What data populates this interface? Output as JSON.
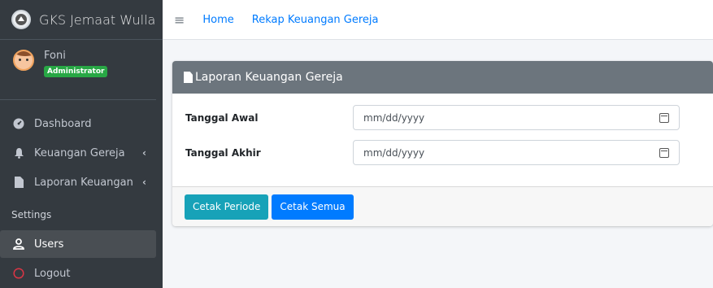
{
  "brand": {
    "title": "GKS Jemaat Wulla",
    "icon": "church-logo-icon"
  },
  "user": {
    "name": "Foni",
    "role": "Administrator"
  },
  "sidebar": {
    "items": [
      {
        "label": "Dashboard",
        "icon": "dashboard-icon"
      },
      {
        "label": "Keuangan Gereja",
        "icon": "bell-icon",
        "chevron": "‹"
      },
      {
        "label": "Laporan Keuangan",
        "icon": "file-icon",
        "chevron": "‹"
      }
    ],
    "section_header": "Settings",
    "settings_items": [
      {
        "label": "Users",
        "icon": "user-icon",
        "active": true
      },
      {
        "label": "Logout",
        "icon": "power-icon"
      }
    ]
  },
  "topbar": {
    "menu_icon": "≡",
    "links": [
      "Home",
      "Rekap Keuangan Gereja"
    ]
  },
  "card": {
    "title": "Laporan Keuangan Gereja",
    "fields": [
      {
        "label": "Tanggal Awal",
        "placeholder": "mm/dd/yyyy"
      },
      {
        "label": "Tanggal Akhir",
        "placeholder": "mm/dd/yyyy"
      }
    ],
    "buttons": {
      "period": "Cetak Periode",
      "all": "Cetak Semua"
    }
  },
  "colors": {
    "sidebar": "#343a40",
    "primary": "#007bff",
    "info": "#17a2b8",
    "success": "#28a745",
    "card_header": "#6c757d",
    "logout_icon": "#dc3545"
  }
}
